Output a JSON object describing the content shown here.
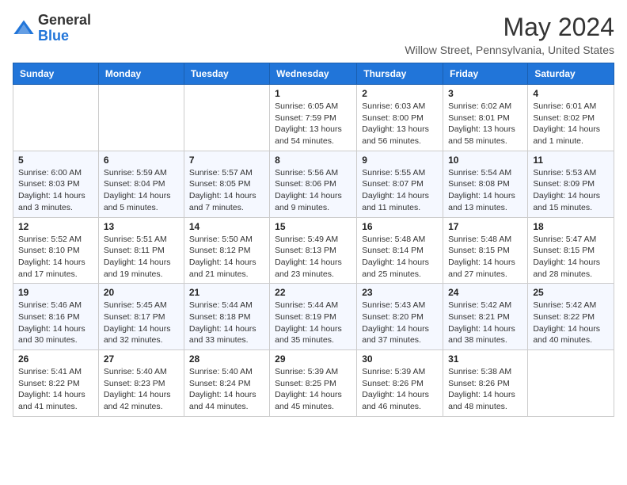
{
  "header": {
    "logo_general": "General",
    "logo_blue": "Blue",
    "title": "May 2024",
    "location": "Willow Street, Pennsylvania, United States"
  },
  "days_of_week": [
    "Sunday",
    "Monday",
    "Tuesday",
    "Wednesday",
    "Thursday",
    "Friday",
    "Saturday"
  ],
  "weeks": [
    [
      {
        "day": "",
        "info": ""
      },
      {
        "day": "",
        "info": ""
      },
      {
        "day": "",
        "info": ""
      },
      {
        "day": "1",
        "info": "Sunrise: 6:05 AM\nSunset: 7:59 PM\nDaylight: 13 hours and 54 minutes."
      },
      {
        "day": "2",
        "info": "Sunrise: 6:03 AM\nSunset: 8:00 PM\nDaylight: 13 hours and 56 minutes."
      },
      {
        "day": "3",
        "info": "Sunrise: 6:02 AM\nSunset: 8:01 PM\nDaylight: 13 hours and 58 minutes."
      },
      {
        "day": "4",
        "info": "Sunrise: 6:01 AM\nSunset: 8:02 PM\nDaylight: 14 hours and 1 minute."
      }
    ],
    [
      {
        "day": "5",
        "info": "Sunrise: 6:00 AM\nSunset: 8:03 PM\nDaylight: 14 hours and 3 minutes."
      },
      {
        "day": "6",
        "info": "Sunrise: 5:59 AM\nSunset: 8:04 PM\nDaylight: 14 hours and 5 minutes."
      },
      {
        "day": "7",
        "info": "Sunrise: 5:57 AM\nSunset: 8:05 PM\nDaylight: 14 hours and 7 minutes."
      },
      {
        "day": "8",
        "info": "Sunrise: 5:56 AM\nSunset: 8:06 PM\nDaylight: 14 hours and 9 minutes."
      },
      {
        "day": "9",
        "info": "Sunrise: 5:55 AM\nSunset: 8:07 PM\nDaylight: 14 hours and 11 minutes."
      },
      {
        "day": "10",
        "info": "Sunrise: 5:54 AM\nSunset: 8:08 PM\nDaylight: 14 hours and 13 minutes."
      },
      {
        "day": "11",
        "info": "Sunrise: 5:53 AM\nSunset: 8:09 PM\nDaylight: 14 hours and 15 minutes."
      }
    ],
    [
      {
        "day": "12",
        "info": "Sunrise: 5:52 AM\nSunset: 8:10 PM\nDaylight: 14 hours and 17 minutes."
      },
      {
        "day": "13",
        "info": "Sunrise: 5:51 AM\nSunset: 8:11 PM\nDaylight: 14 hours and 19 minutes."
      },
      {
        "day": "14",
        "info": "Sunrise: 5:50 AM\nSunset: 8:12 PM\nDaylight: 14 hours and 21 minutes."
      },
      {
        "day": "15",
        "info": "Sunrise: 5:49 AM\nSunset: 8:13 PM\nDaylight: 14 hours and 23 minutes."
      },
      {
        "day": "16",
        "info": "Sunrise: 5:48 AM\nSunset: 8:14 PM\nDaylight: 14 hours and 25 minutes."
      },
      {
        "day": "17",
        "info": "Sunrise: 5:48 AM\nSunset: 8:15 PM\nDaylight: 14 hours and 27 minutes."
      },
      {
        "day": "18",
        "info": "Sunrise: 5:47 AM\nSunset: 8:15 PM\nDaylight: 14 hours and 28 minutes."
      }
    ],
    [
      {
        "day": "19",
        "info": "Sunrise: 5:46 AM\nSunset: 8:16 PM\nDaylight: 14 hours and 30 minutes."
      },
      {
        "day": "20",
        "info": "Sunrise: 5:45 AM\nSunset: 8:17 PM\nDaylight: 14 hours and 32 minutes."
      },
      {
        "day": "21",
        "info": "Sunrise: 5:44 AM\nSunset: 8:18 PM\nDaylight: 14 hours and 33 minutes."
      },
      {
        "day": "22",
        "info": "Sunrise: 5:44 AM\nSunset: 8:19 PM\nDaylight: 14 hours and 35 minutes."
      },
      {
        "day": "23",
        "info": "Sunrise: 5:43 AM\nSunset: 8:20 PM\nDaylight: 14 hours and 37 minutes."
      },
      {
        "day": "24",
        "info": "Sunrise: 5:42 AM\nSunset: 8:21 PM\nDaylight: 14 hours and 38 minutes."
      },
      {
        "day": "25",
        "info": "Sunrise: 5:42 AM\nSunset: 8:22 PM\nDaylight: 14 hours and 40 minutes."
      }
    ],
    [
      {
        "day": "26",
        "info": "Sunrise: 5:41 AM\nSunset: 8:22 PM\nDaylight: 14 hours and 41 minutes."
      },
      {
        "day": "27",
        "info": "Sunrise: 5:40 AM\nSunset: 8:23 PM\nDaylight: 14 hours and 42 minutes."
      },
      {
        "day": "28",
        "info": "Sunrise: 5:40 AM\nSunset: 8:24 PM\nDaylight: 14 hours and 44 minutes."
      },
      {
        "day": "29",
        "info": "Sunrise: 5:39 AM\nSunset: 8:25 PM\nDaylight: 14 hours and 45 minutes."
      },
      {
        "day": "30",
        "info": "Sunrise: 5:39 AM\nSunset: 8:26 PM\nDaylight: 14 hours and 46 minutes."
      },
      {
        "day": "31",
        "info": "Sunrise: 5:38 AM\nSunset: 8:26 PM\nDaylight: 14 hours and 48 minutes."
      },
      {
        "day": "",
        "info": ""
      }
    ]
  ]
}
